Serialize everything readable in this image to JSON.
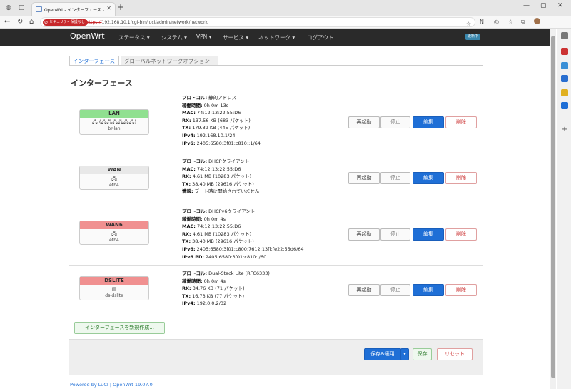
{
  "browser": {
    "tab_title": "OpenWrt - インターフェース - LuCI",
    "security_badge": "セキュリティ保護なし",
    "url_scheme": "https://",
    "url_rest": "192.168.10.1/cgi-bin/luci/admin/network/network"
  },
  "header": {
    "brand": "OpenWrt",
    "menu": [
      "ステータス ▾",
      "システム ▾",
      "VPN ▾",
      "サービス ▾",
      "ネットワーク ▾",
      "ログアウト"
    ],
    "update_badge": "更新中"
  },
  "tabs": [
    "インターフェース",
    "グローバルネットワークオプション"
  ],
  "section_title": "インターフェース",
  "interfaces": [
    {
      "name": "LAN",
      "color": "#90e090",
      "device": "br-lan",
      "icons": "🖧 (🖧🖧🖧🖧🖧🖧)",
      "lines": [
        {
          "k": "プロトコル:",
          "v": " 静的アドレス"
        },
        {
          "k": "稼働時間:",
          "v": " 0h 0m 13s"
        },
        {
          "k": "MAC:",
          "v": " 74:12:13:22:55:D6"
        },
        {
          "k": "RX:",
          "v": " 137.56 KB (683 パケット)"
        },
        {
          "k": "TX:",
          "v": " 179.39 KB (445 パケット)"
        },
        {
          "k": "IPv4:",
          "v": " 192.168.10.1/24"
        },
        {
          "k": "IPv6:",
          "v": " 2405:6580:3f01:c810::1/64"
        }
      ]
    },
    {
      "name": "WAN",
      "color": "#e8e8e8",
      "device": "eth4",
      "icons": "🖧",
      "lines": [
        {
          "k": "プロトコル:",
          "v": " DHCPクライアント"
        },
        {
          "k": "MAC:",
          "v": " 74:12:13:22:55:D6"
        },
        {
          "k": "RX:",
          "v": " 4.61 MB (10283 パケット)"
        },
        {
          "k": "TX:",
          "v": " 38.40 MB (29616 パケット)"
        },
        {
          "k": "情報:",
          "v": " ブート時に開始されていません"
        }
      ]
    },
    {
      "name": "WAN6",
      "color": "#f09090",
      "device": "eth4",
      "icons": "🖧",
      "lines": [
        {
          "k": "プロトコル:",
          "v": " DHCPv6クライアント"
        },
        {
          "k": "稼働時間:",
          "v": " 0h 0m 4s"
        },
        {
          "k": "MAC:",
          "v": " 74:12:13:22:55:D6"
        },
        {
          "k": "RX:",
          "v": " 4.61 MB (10283 パケット)"
        },
        {
          "k": "TX:",
          "v": " 38.40 MB (29616 パケット)"
        },
        {
          "k": "IPv6:",
          "v": " 2405:6580:3f01:c800:7612:13ff:fe22:55d6/64"
        },
        {
          "k": "IPv6 PD:",
          "v": " 2405:6580:3f01:c810::/60"
        }
      ]
    },
    {
      "name": "DSLITE",
      "color": "#f09090",
      "device": "ds-dslite",
      "icons": "▤",
      "lines": [
        {
          "k": "プロトコル:",
          "v": " Dual-Stack Lite (RFC6333)"
        },
        {
          "k": "稼働時間:",
          "v": " 0h 0m 4s"
        },
        {
          "k": "RX:",
          "v": " 34.76 KB (71 パケット)"
        },
        {
          "k": "TX:",
          "v": " 16.73 KB (77 パケット)"
        },
        {
          "k": "IPv4:",
          "v": " 192.0.0.2/32"
        }
      ]
    }
  ],
  "row_buttons": {
    "restart": "再起動",
    "stop": "停止",
    "edit": "編集",
    "delete": "削除"
  },
  "add_interface": "インターフェースを新規作成...",
  "footer_buttons": {
    "save_apply": "保存&適用",
    "save": "保存",
    "reset": "リセット"
  },
  "powered_by": "Powered by LuCI | OpenWrt 19.07.0"
}
